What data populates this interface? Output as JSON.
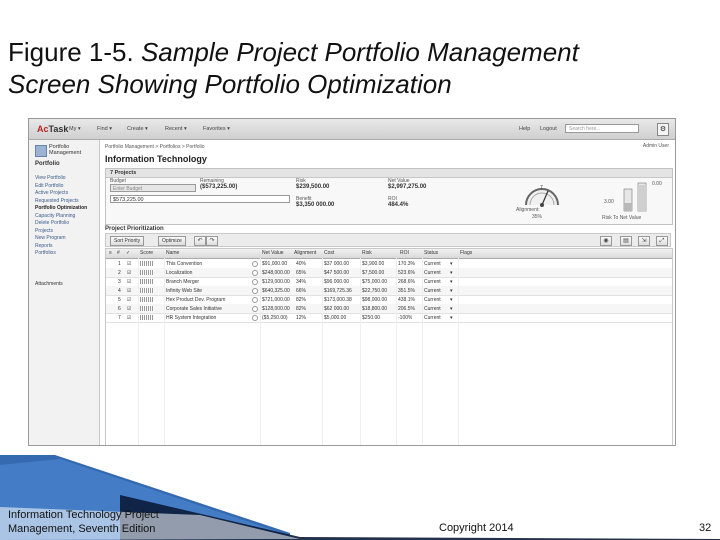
{
  "slide": {
    "title_prefix": "Figure 1-5.",
    "title_line1": " Sample Project Portfolio Management",
    "title_line2": "Screen Showing Portfolio Optimization",
    "footer_left_line1": "Information Technology Project",
    "footer_left_line2": "Management, Seventh Edition",
    "footer_copyright": "Copyright 2014",
    "page_number": "32"
  },
  "app": {
    "logo_a": "Ac",
    "logo_b": "Task",
    "menu": [
      "My",
      "Find",
      "Create",
      "Recent",
      "Favorites"
    ],
    "top_links": [
      "Help",
      "Logout"
    ],
    "search_placeholder": "Search here..."
  },
  "sidebar": {
    "header": "Portfolio Management",
    "section": "Portfolio",
    "items": [
      "View Portfolio",
      "Edit Portfolio",
      "Active Projects",
      "Requested Projects",
      "Portfolio Optimization",
      "Capacity Planning",
      "Delete Portfolio",
      "Projects",
      "New Program",
      "Reports",
      "Portfolios"
    ],
    "attachments": "Attachments"
  },
  "main": {
    "breadcrumb": "Portfolio Management > Portfolios > Portfolio",
    "admin": "Admin User",
    "page_title": "Information Technology",
    "summary": {
      "projects": "7 Projects",
      "budget_label": "Budget",
      "budget_placeholder": "Enter Budget",
      "budget_value": "$573,225.00",
      "remaining_label": "Remaining",
      "remaining_value": "($573,225.00)",
      "risk_label": "Risk",
      "risk_value": "$239,500.00",
      "benefit_label": "Benefit",
      "benefit_value": "$3,350 000.00",
      "net_value_label": "Net Value",
      "net_value_value": "$2,997,275.00",
      "roi_label": "ROI",
      "roi_value": "484.4%",
      "gauge_value": "7",
      "alignment_label": "Alignment:",
      "alignment_value": "35%",
      "bar_label": "Risk To Net Value",
      "bar_top": "0.00",
      "bar_mid": "3.00"
    },
    "prioritization_title": "Project Prioritization",
    "toolbar": {
      "sort_label": "Sort Priority",
      "optimize_label": "Optimize"
    },
    "grid": {
      "columns": [
        "#",
        "✓",
        "Score",
        "Name",
        "",
        "Net Value",
        "Alignment",
        "Cost",
        "Risk",
        "ROI",
        "Status",
        "Flags"
      ],
      "rows": [
        [
          "1",
          "☑",
          "This Convention",
          "$91,000.00",
          "40%",
          "$37 000.00",
          "$3,900.00",
          "170.3%",
          "Current"
        ],
        [
          "2",
          "☑",
          "Localization",
          "$248,000.00",
          "65%",
          "$47 500.00",
          "$7,500.00",
          "523.6%",
          "Current"
        ],
        [
          "3",
          "☑",
          "Branch Merger",
          "$129,000.00",
          "34%",
          "$96 000.00",
          "$75,000.00",
          "268.6%",
          "Current"
        ],
        [
          "4",
          "☑",
          "Infinity Web Site",
          "$640,325.00",
          "66%",
          "$169,725.36",
          "$22,750.00",
          "351.5%",
          "Current"
        ],
        [
          "5",
          "☑",
          "Hex Product Dev. Program",
          "$721,000.00",
          "82%",
          "$173,000.38",
          "$98,000.00",
          "438.1%",
          "Current"
        ],
        [
          "6",
          "☑",
          "Corporate Sales Initiative",
          "$128,000.00",
          "82%",
          "$62 000.00",
          "$18,800.00",
          "206.5%",
          "Current"
        ],
        [
          "7",
          "☑",
          "HR System Integration",
          "($5,250.00)",
          "12%",
          "$5,000.00",
          "$250.00",
          "-100%",
          "Current"
        ]
      ]
    }
  },
  "colors": {
    "logo_accent": "#b22222",
    "link": "#3a5a8a",
    "footer_blue": "#1f5aa8"
  }
}
